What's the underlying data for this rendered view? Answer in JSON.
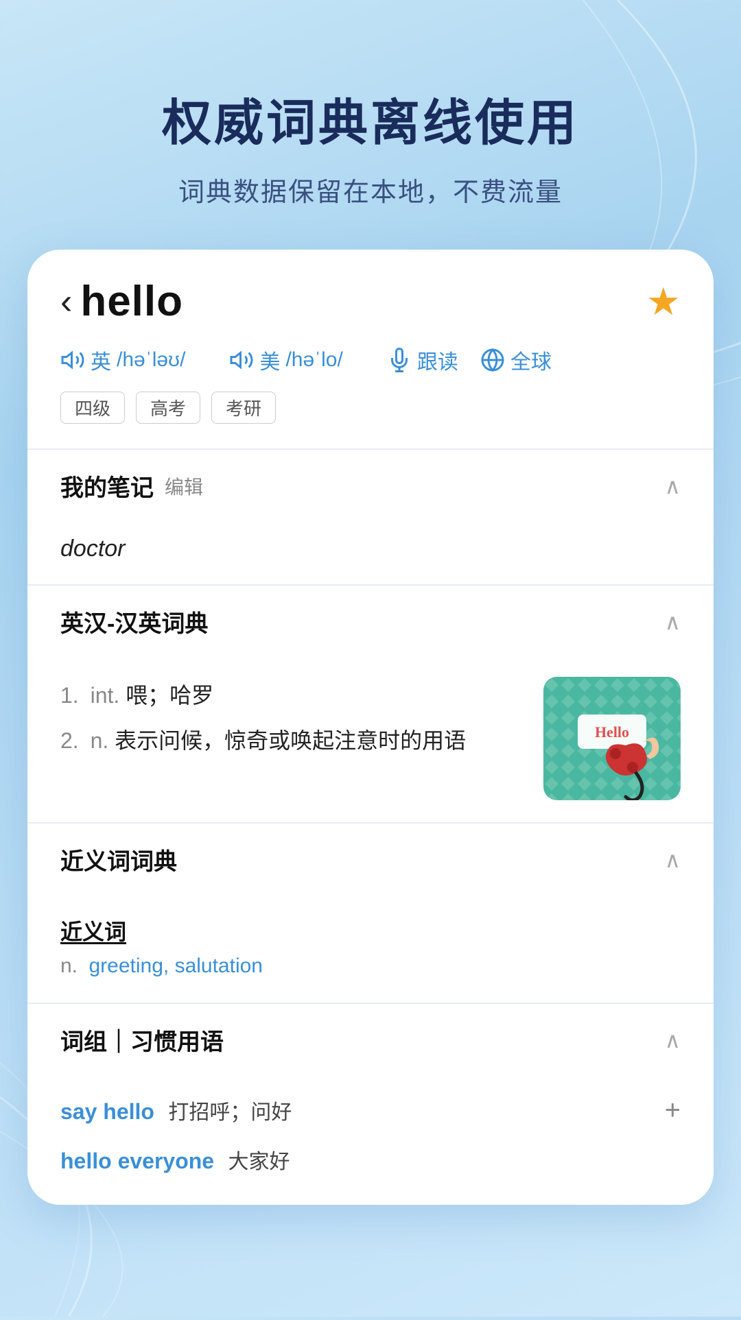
{
  "background": {
    "color_top": "#c8e6f7",
    "color_bottom": "#b0d8f5"
  },
  "top_section": {
    "main_title": "权威词典离线使用",
    "sub_title": "词典数据保留在本地，不费流量"
  },
  "word_card": {
    "back_label": "‹",
    "word": "hello",
    "star_label": "★",
    "phonetics": [
      {
        "lang": "英",
        "symbol": "/həˈləʊ/"
      },
      {
        "lang": "美",
        "symbol": "/həˈlo/"
      }
    ],
    "follow_read_label": "跟读",
    "global_label": "全球",
    "tags": [
      "四级",
      "高考",
      "考研"
    ]
  },
  "notes_section": {
    "title": "我的笔记",
    "edit_label": "编辑",
    "note_content": "doctor"
  },
  "dict_section": {
    "title": "英汉-汉英词典",
    "definitions": [
      {
        "num": "1.",
        "pos": "int.",
        "meaning": "喂；哈罗"
      },
      {
        "num": "2.",
        "pos": "n.",
        "meaning": "表示问候，惊奇或唤起注意时的用语"
      }
    ]
  },
  "synonym_section": {
    "title": "近义词词典",
    "subtitle": "近义词",
    "pos": "n.",
    "words": "greeting, salutation"
  },
  "phrases_section": {
    "title": "词组｜习惯用语",
    "phrases": [
      {
        "english": "say hello",
        "chinese": "打招呼；问好"
      },
      {
        "english": "hello everyone",
        "chinese": "大家好"
      }
    ]
  },
  "icons": {
    "speaker": "🔊",
    "mic": "🎤",
    "global": "🔄",
    "plus": "+"
  }
}
